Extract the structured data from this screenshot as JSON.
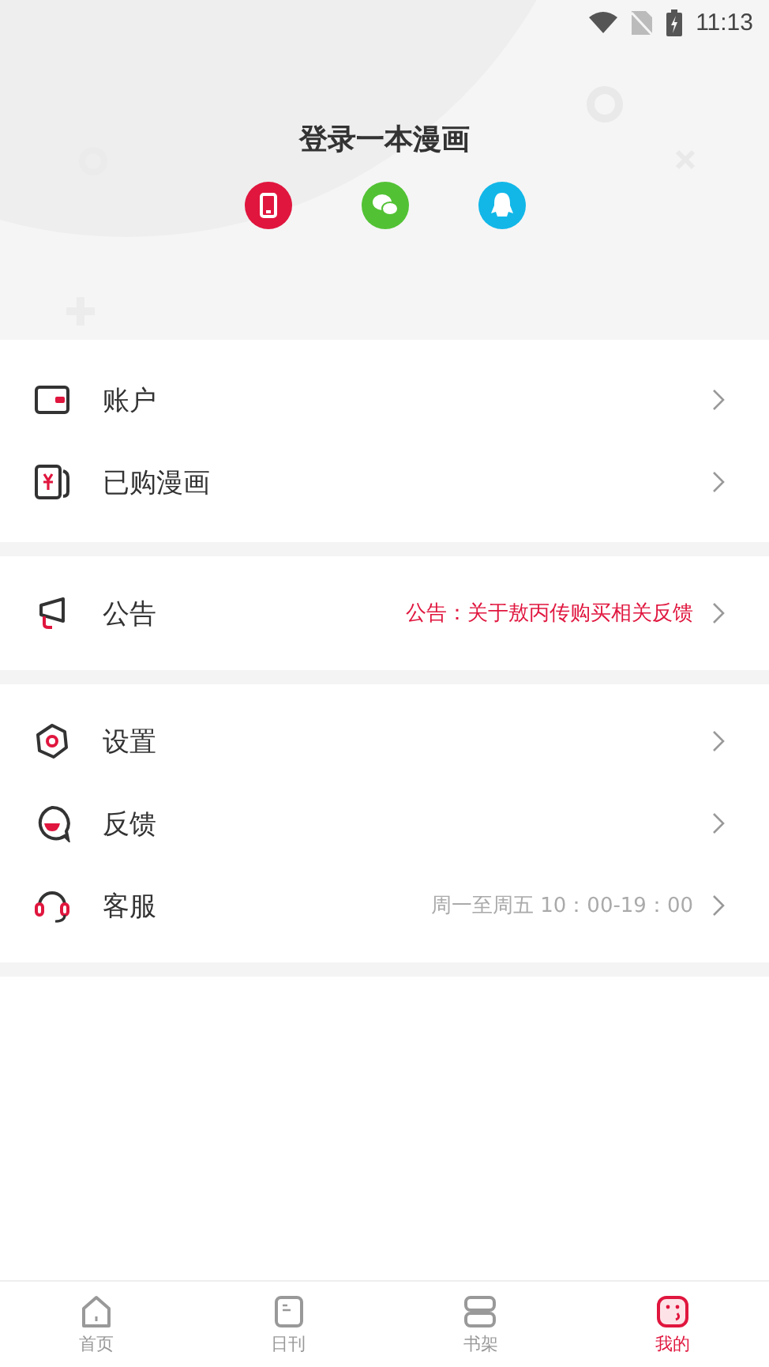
{
  "status_bar": {
    "time": "11:13"
  },
  "header": {
    "title": "登录一本漫画"
  },
  "menu_groups": [
    {
      "items": [
        {
          "label": "账户"
        },
        {
          "label": "已购漫画"
        }
      ]
    },
    {
      "items": [
        {
          "label": "公告",
          "note": {
            "text": "公告：关于敖丙传购买相关反馈",
            "kind": "notice"
          }
        }
      ]
    },
    {
      "items": [
        {
          "label": "设置"
        },
        {
          "label": "反馈"
        },
        {
          "label": "客服",
          "note": {
            "text": "周一至周五 10：00-19：00",
            "kind": "hours"
          }
        }
      ]
    }
  ],
  "tabs": [
    {
      "label": "首页",
      "selected": false
    },
    {
      "label": "日刊",
      "selected": false
    },
    {
      "label": "书架",
      "selected": false
    },
    {
      "label": "我的",
      "selected": true
    }
  ]
}
